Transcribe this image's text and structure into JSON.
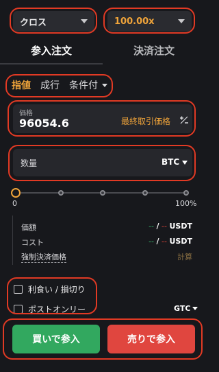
{
  "top": {
    "margin_mode": "クロス",
    "leverage": "100.00x"
  },
  "tabs": [
    {
      "label": "参入注文"
    },
    {
      "label": "決済注文"
    }
  ],
  "order_types": {
    "limit": "指値",
    "market": "成行",
    "conditional": "条件付"
  },
  "price": {
    "label": "価格",
    "value": "96054.6",
    "last_price_label": "最終取引価格",
    "icon": "plus-minus-icon"
  },
  "quantity": {
    "label": "数量",
    "unit": "BTC"
  },
  "slider": {
    "min_label": "0",
    "max_label": "100%",
    "value_percent": 0
  },
  "summary": {
    "value_label": "価額",
    "value_left": "--",
    "value_sep": "/",
    "value_right": "--",
    "value_unit": "USDT",
    "cost_label": "コスト",
    "cost_left": "--",
    "cost_sep": "/",
    "cost_right": "--",
    "cost_unit": "USDT",
    "liq_label": "強制決済価格",
    "liq_action": "計算"
  },
  "options": {
    "tp_sl": "利食い / 損切り",
    "post_only": "ポストオンリー",
    "tif": "GTC"
  },
  "actions": {
    "buy": "買いで参入",
    "sell": "売りで参入"
  },
  "colors": {
    "accent": "#f0a43a",
    "buy": "#32a85f",
    "sell": "#e0463f",
    "highlight": "#e23a24"
  }
}
